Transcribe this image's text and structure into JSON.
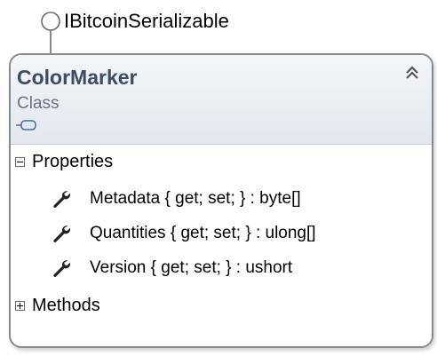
{
  "interface": {
    "name": "IBitcoinSerializable"
  },
  "class": {
    "name": "ColorMarker",
    "stereotype": "Class",
    "type_icon": "class-shape-icon",
    "collapse_icon": "double-chevron-up-icon"
  },
  "compartments": {
    "properties": {
      "label": "Properties",
      "state": "expanded",
      "toggle_icon": "minus-box-icon",
      "items": [
        {
          "text": "Metadata { get; set; } : byte[]",
          "icon": "wrench-icon"
        },
        {
          "text": "Quantities { get; set; } : ulong[]",
          "icon": "wrench-icon"
        },
        {
          "text": "Version { get; set; } : ushort",
          "icon": "wrench-icon"
        }
      ]
    },
    "methods": {
      "label": "Methods",
      "state": "collapsed",
      "toggle_icon": "plus-box-icon"
    }
  },
  "colors": {
    "class_name": "#3b4c64",
    "stereotype": "#6a7380",
    "border": "#8a8a8a",
    "header_top": "#f3f6fa",
    "header_bottom": "#e3e8ef"
  }
}
